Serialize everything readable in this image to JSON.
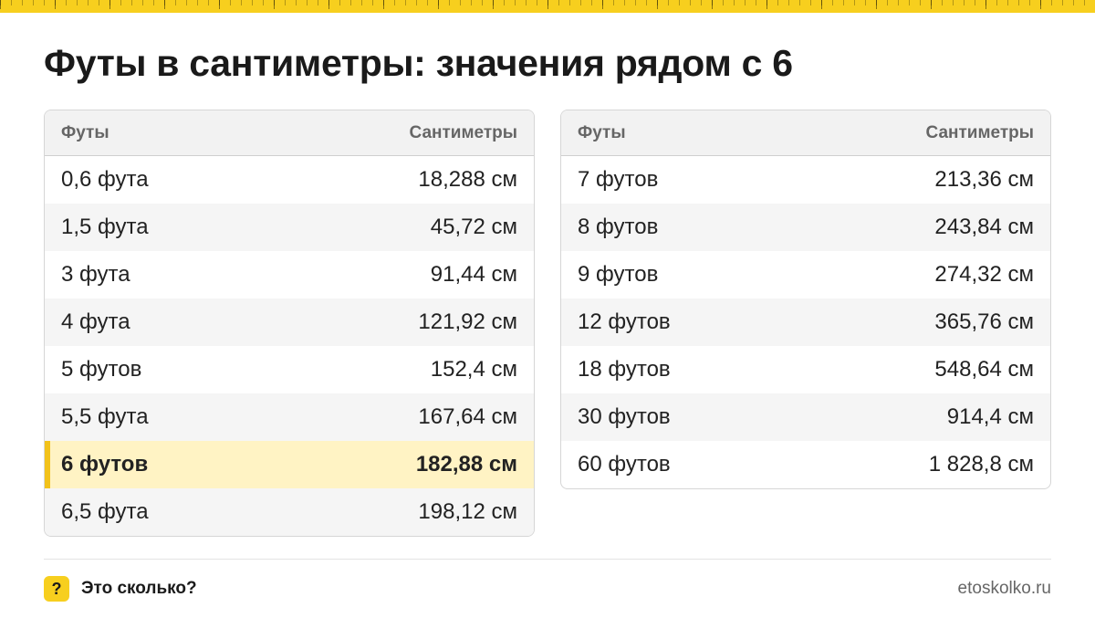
{
  "page": {
    "title": "Футы в сантиметры: значения рядом с 6",
    "accent_color": "#f7cf1e",
    "highlight_color": "#fff3c4"
  },
  "tables": {
    "left": {
      "headers": {
        "feet": "Футы",
        "cm": "Сантиметры"
      },
      "rows": [
        {
          "feet": "0,6 фута",
          "cm": "18,288 см"
        },
        {
          "feet": "1,5 фута",
          "cm": "45,72 см"
        },
        {
          "feet": "3 фута",
          "cm": "91,44 см"
        },
        {
          "feet": "4 фута",
          "cm": "121,92 см"
        },
        {
          "feet": "5 футов",
          "cm": "152,4 см"
        },
        {
          "feet": "5,5 фута",
          "cm": "167,64 см"
        },
        {
          "feet": "6 футов",
          "cm": "182,88 см",
          "highlighted": true
        },
        {
          "feet": "6,5 фута",
          "cm": "198,12 см"
        }
      ]
    },
    "right": {
      "headers": {
        "feet": "Футы",
        "cm": "Сантиметры"
      },
      "rows": [
        {
          "feet": "7 футов",
          "cm": "213,36 см"
        },
        {
          "feet": "8 футов",
          "cm": "243,84 см"
        },
        {
          "feet": "9 футов",
          "cm": "274,32 см"
        },
        {
          "feet": "12 футов",
          "cm": "365,76 см"
        },
        {
          "feet": "18 футов",
          "cm": "548,64 см"
        },
        {
          "feet": "30 футов",
          "cm": "914,4 см"
        },
        {
          "feet": "60 футов",
          "cm": "1 828,8 см"
        }
      ]
    }
  },
  "footer": {
    "brand_badge": "?",
    "brand_name": "Это сколько?",
    "site": "etoskolko.ru",
    "badge_icon": "question-mark-icon"
  }
}
